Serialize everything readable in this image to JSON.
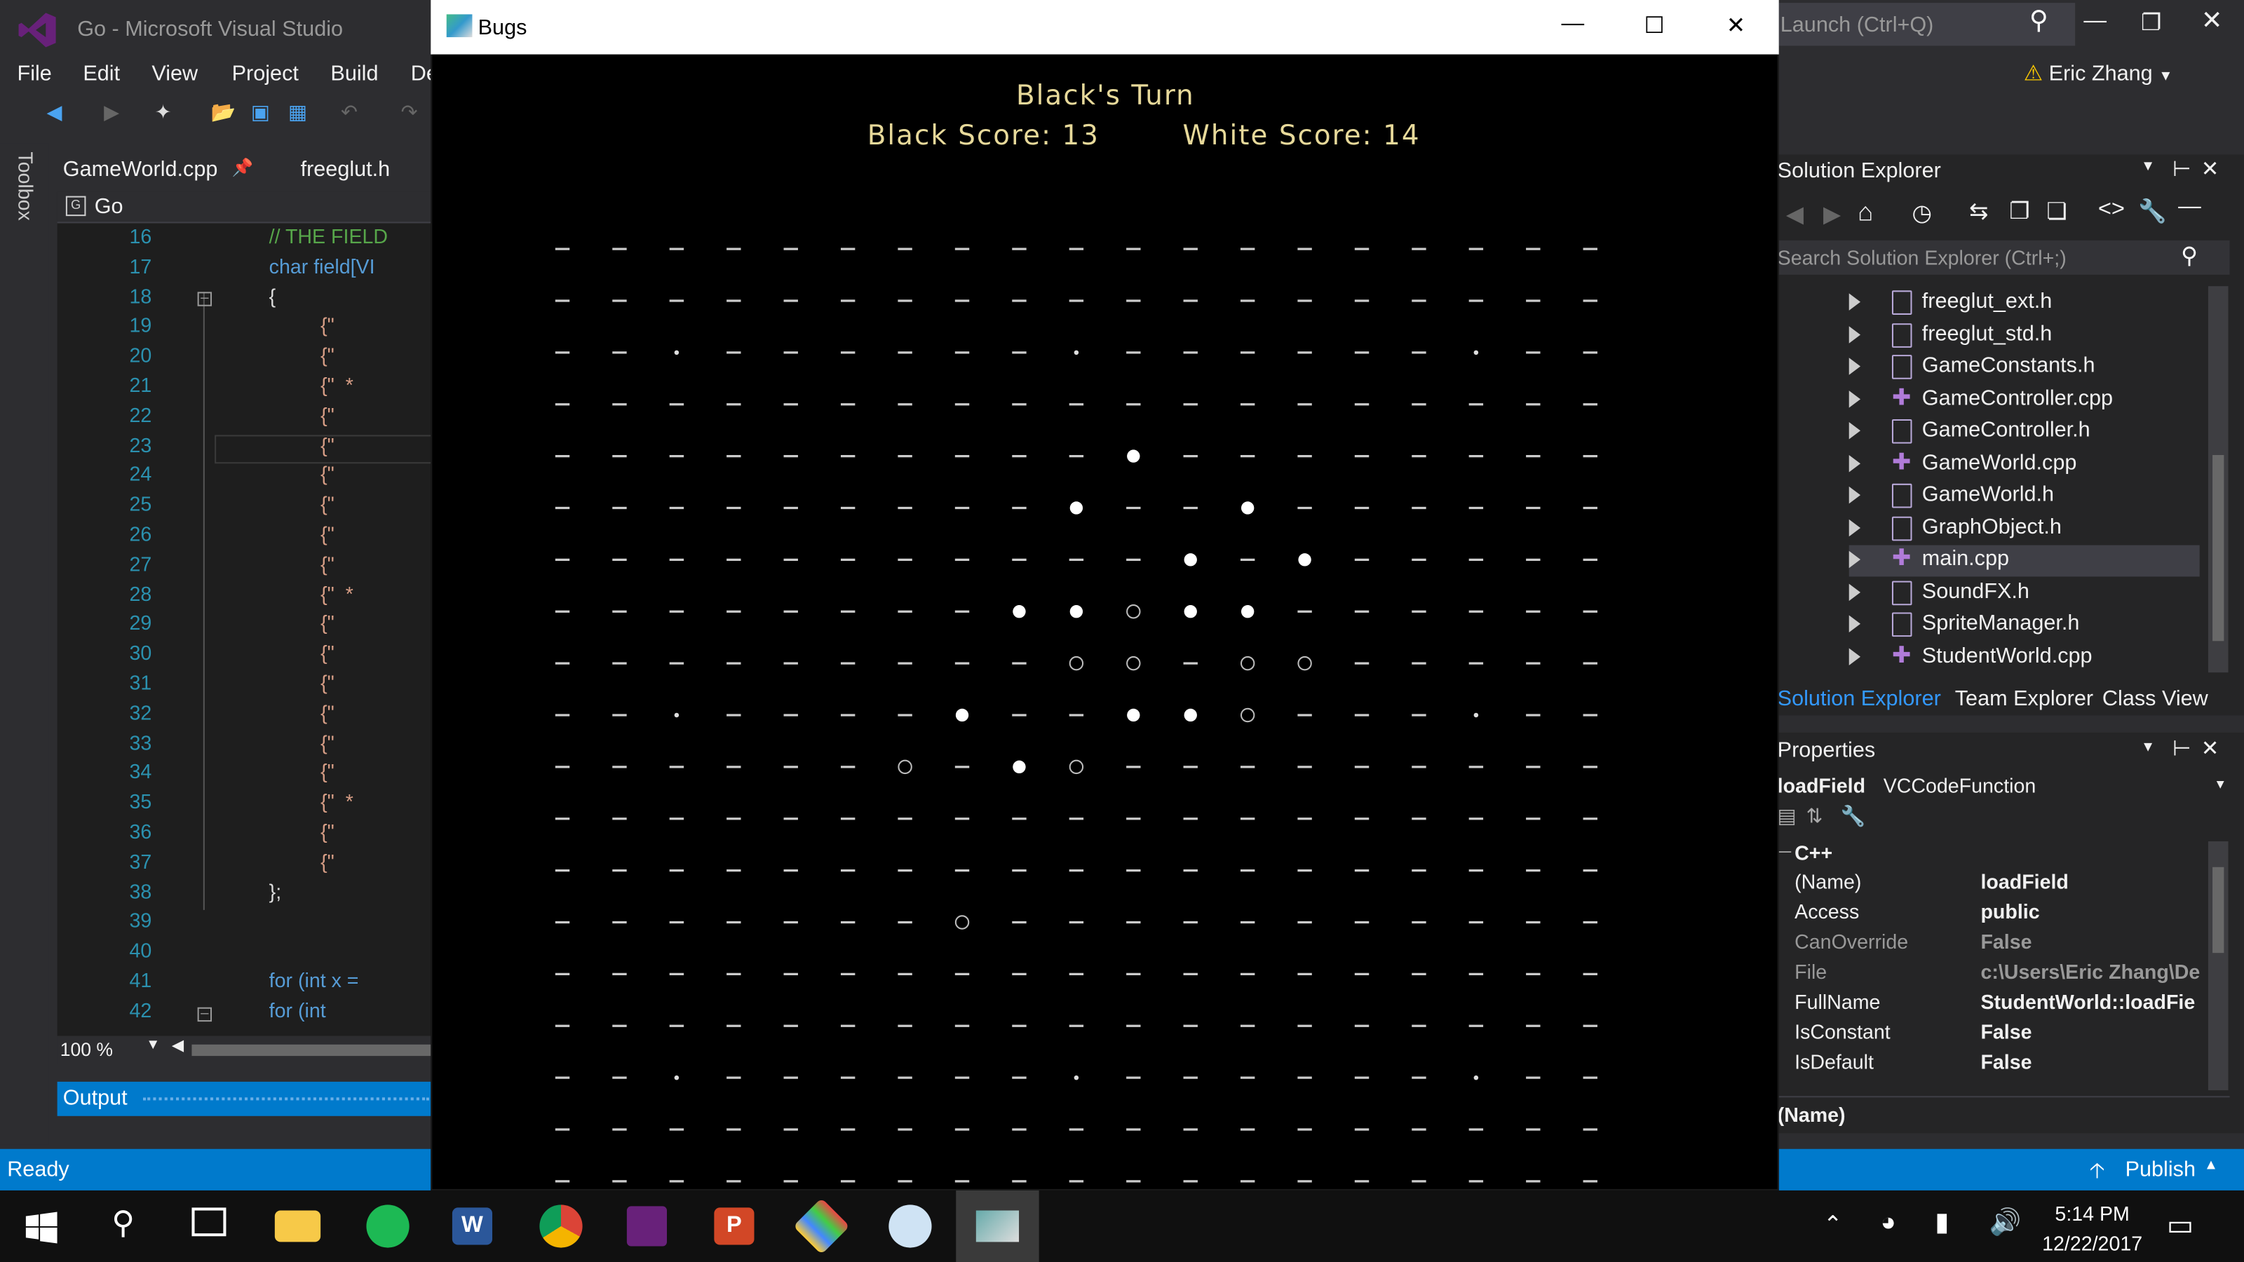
{
  "vs": {
    "title": "Go - Microsoft Visual Studio",
    "menu": [
      "File",
      "Edit",
      "View",
      "Project",
      "Build",
      "De"
    ],
    "quick_launch": "Launch (Ctrl+Q)",
    "user": "Eric Zhang",
    "toolbox_label": "Toolbox",
    "tabs": [
      "GameWorld.cpp",
      "freeglut.h"
    ],
    "nav_scope": "Go",
    "code_lines": [
      {
        "n": "16",
        "t": "// THE FIELD"
      },
      {
        "n": "17",
        "t": "char field[VI"
      },
      {
        "n": "18",
        "t": "{"
      },
      {
        "n": "19",
        "t": "    {\""
      },
      {
        "n": "20",
        "t": "    {\""
      },
      {
        "n": "21",
        "t": "    {\"  *"
      },
      {
        "n": "22",
        "t": "    {\""
      },
      {
        "n": "23",
        "t": "    {\""
      },
      {
        "n": "24",
        "t": "    {\""
      },
      {
        "n": "25",
        "t": "    {\""
      },
      {
        "n": "26",
        "t": "    {\""
      },
      {
        "n": "27",
        "t": "    {\""
      },
      {
        "n": "28",
        "t": "    {\"  *"
      },
      {
        "n": "29",
        "t": "    {\""
      },
      {
        "n": "30",
        "t": "    {\""
      },
      {
        "n": "31",
        "t": "    {\""
      },
      {
        "n": "32",
        "t": "    {\""
      },
      {
        "n": "33",
        "t": "    {\""
      },
      {
        "n": "34",
        "t": "    {\""
      },
      {
        "n": "35",
        "t": "    {\"  *"
      },
      {
        "n": "36",
        "t": "    {\""
      },
      {
        "n": "37",
        "t": "    {\""
      },
      {
        "n": "38",
        "t": "};"
      },
      {
        "n": "39",
        "t": ""
      },
      {
        "n": "40",
        "t": ""
      },
      {
        "n": "41",
        "t": "for (int x ="
      },
      {
        "n": "42",
        "t": "    for (int"
      }
    ],
    "zoom": "100 %",
    "output_label": "Output",
    "status": "Ready",
    "publish": "Publish",
    "solution_explorer": {
      "title": "Solution Explorer",
      "search_placeholder": "Search Solution Explorer (Ctrl+;)",
      "files": [
        {
          "name": "freeglut_ext.h",
          "type": "h"
        },
        {
          "name": "freeglut_std.h",
          "type": "h"
        },
        {
          "name": "GameConstants.h",
          "type": "h"
        },
        {
          "name": "GameController.cpp",
          "type": "cpp"
        },
        {
          "name": "GameController.h",
          "type": "h"
        },
        {
          "name": "GameWorld.cpp",
          "type": "cpp"
        },
        {
          "name": "GameWorld.h",
          "type": "h"
        },
        {
          "name": "GraphObject.h",
          "type": "h"
        },
        {
          "name": "main.cpp",
          "type": "cpp",
          "selected": true
        },
        {
          "name": "SoundFX.h",
          "type": "h"
        },
        {
          "name": "SpriteManager.h",
          "type": "h"
        },
        {
          "name": "StudentWorld.cpp",
          "type": "cpp"
        }
      ],
      "tabs": [
        "Solution Explorer",
        "Team Explorer",
        "Class View"
      ]
    },
    "properties": {
      "title": "Properties",
      "object": "loadField",
      "object_type": "VCCodeFunction",
      "category": "C++",
      "rows": [
        {
          "k": "(Name)",
          "v": "loadField"
        },
        {
          "k": "Access",
          "v": "public"
        },
        {
          "k": "CanOverride",
          "v": "False"
        },
        {
          "k": "File",
          "v": "c:\\Users\\Eric Zhang\\De"
        },
        {
          "k": "FullName",
          "v": "StudentWorld::loadFie"
        },
        {
          "k": "IsConstant",
          "v": "False"
        },
        {
          "k": "IsDefault",
          "v": "False"
        }
      ],
      "footer": "(Name)"
    }
  },
  "game": {
    "window_title": "Bugs",
    "turn": "Black's Turn",
    "black_label": "Black  Score:",
    "black_score": "13",
    "white_label": "White  Score:",
    "white_score": "14",
    "grid_cols": 19,
    "grid_rows": 19,
    "star_points": [
      [
        2,
        2
      ],
      [
        2,
        9
      ],
      [
        2,
        16
      ],
      [
        9,
        2
      ],
      [
        9,
        16
      ],
      [
        16,
        2
      ],
      [
        16,
        9
      ],
      [
        16,
        16
      ]
    ],
    "black_stones": [
      [
        7,
        8
      ],
      [
        8,
        9
      ],
      [
        8,
        10
      ],
      [
        8,
        12
      ],
      [
        10,
        9
      ],
      [
        7,
        10
      ],
      [
        8,
        13
      ],
      [
        13,
        7
      ],
      [
        7,
        11
      ],
      [
        9,
        10
      ],
      [
        9,
        12
      ],
      [
        9,
        11
      ],
      [
        10,
        6
      ]
    ],
    "white_stones": [
      [
        4,
        10
      ],
      [
        5,
        9
      ],
      [
        5,
        12
      ],
      [
        6,
        11
      ],
      [
        6,
        13
      ],
      [
        7,
        8
      ],
      [
        7,
        9
      ],
      [
        7,
        11
      ],
      [
        7,
        12
      ],
      [
        9,
        7
      ],
      [
        9,
        10
      ],
      [
        9,
        11
      ],
      [
        10,
        8
      ]
    ]
  },
  "taskbar": {
    "time": "5:14 PM",
    "date": "12/22/2017"
  }
}
